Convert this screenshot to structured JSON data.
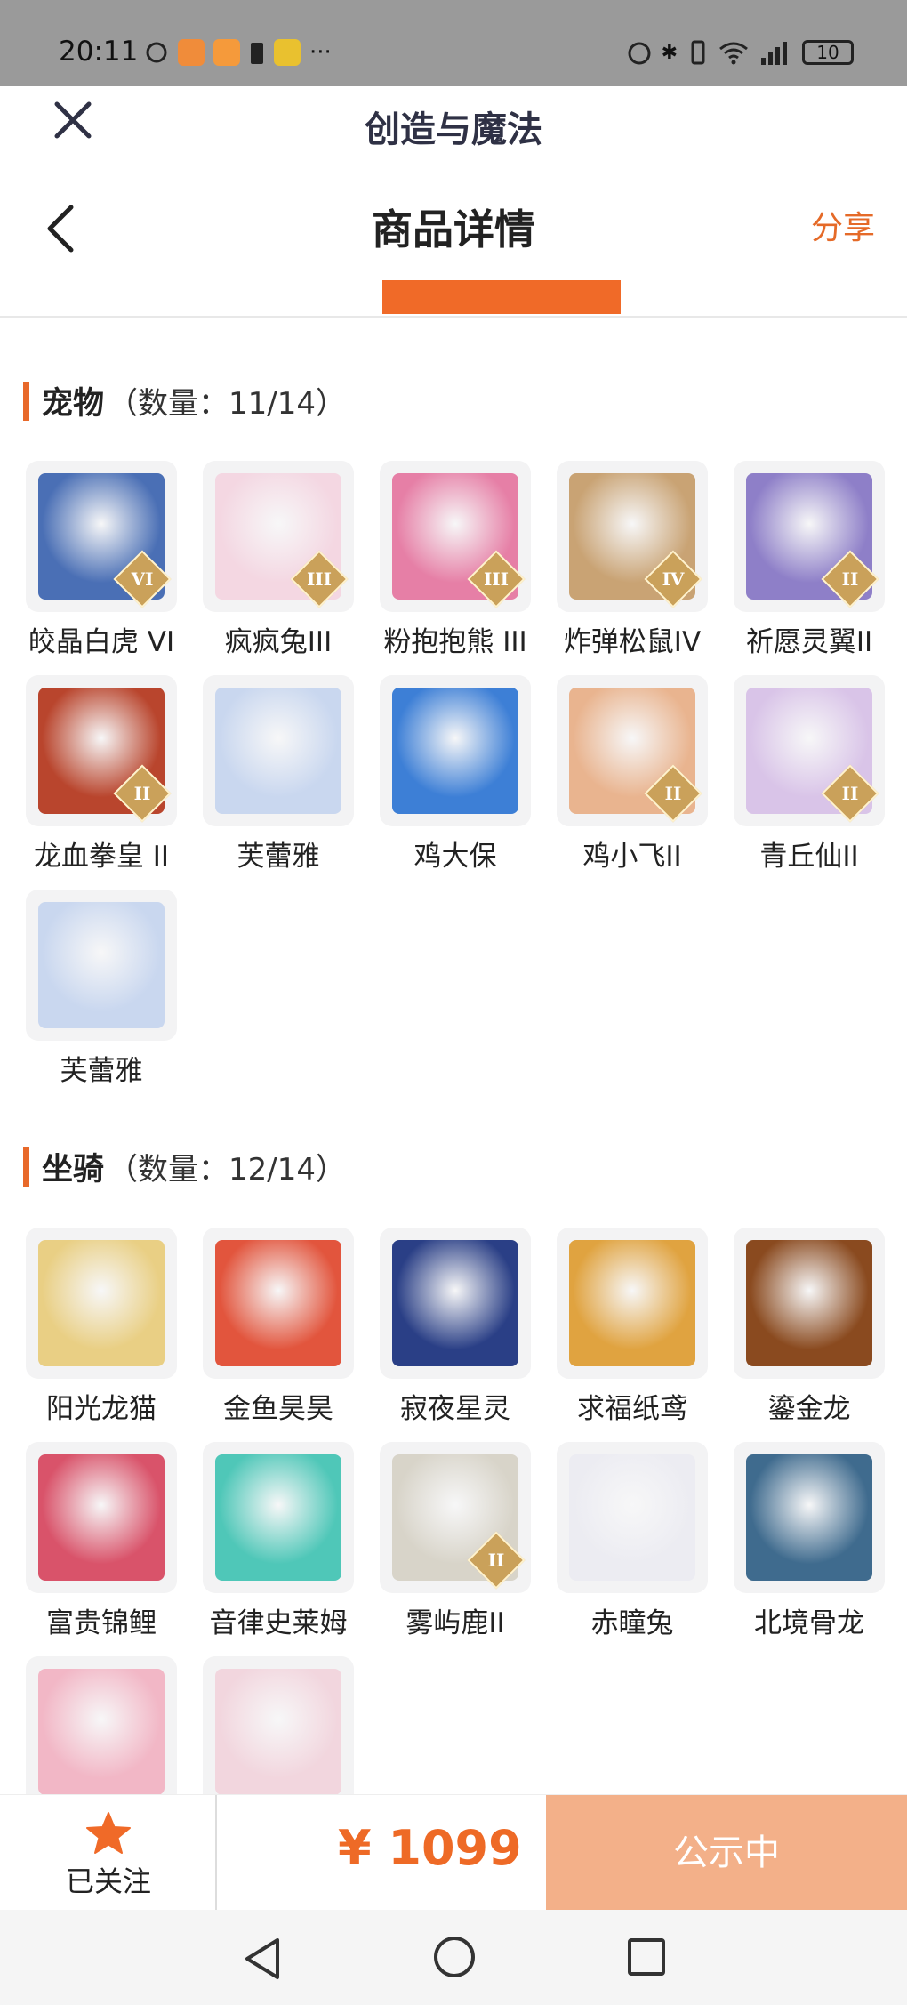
{
  "status_bar": {
    "time": "20:11",
    "battery": "10"
  },
  "app_bar": {
    "title": "创造与魔法"
  },
  "nav_bar": {
    "title": "商品详情",
    "share": "分享"
  },
  "sections": [
    {
      "name": "宠物",
      "count": "（数量：11/14）",
      "items": [
        {
          "name": "皎晶白虎 VI",
          "badge": "VI",
          "color": "#4a6fb5"
        },
        {
          "name": "疯疯兔III",
          "badge": "III",
          "color": "#f4d7e2"
        },
        {
          "name": "粉抱抱熊 III",
          "badge": "III",
          "color": "#e67fa6"
        },
        {
          "name": "炸弹松鼠IV",
          "badge": "IV",
          "color": "#c9a374"
        },
        {
          "name": "祈愿灵翼II",
          "badge": "II",
          "color": "#8e7fc8"
        },
        {
          "name": "龙血拳皇 II",
          "badge": "II",
          "color": "#b9452d"
        },
        {
          "name": "芙蕾雅",
          "badge": "",
          "color": "#c9d7ef"
        },
        {
          "name": "鸡大保",
          "badge": "",
          "color": "#3d7fd6"
        },
        {
          "name": "鸡小飞II",
          "badge": "II",
          "color": "#e9b48f"
        },
        {
          "name": "青丘仙II",
          "badge": "II",
          "color": "#d9c4e8"
        },
        {
          "name": "芙蕾雅",
          "badge": "",
          "color": "#c9d7ef"
        }
      ]
    },
    {
      "name": "坐骑",
      "count": "（数量：12/14）",
      "items": [
        {
          "name": "阳光龙猫",
          "badge": "",
          "color": "#e9cf84"
        },
        {
          "name": "金鱼昊昊",
          "badge": "",
          "color": "#e2553d"
        },
        {
          "name": "寂夜星灵",
          "badge": "",
          "color": "#2a3f86"
        },
        {
          "name": "求福纸鸢",
          "badge": "",
          "color": "#e0a340"
        },
        {
          "name": "鎏金龙",
          "badge": "",
          "color": "#8a4a1f"
        },
        {
          "name": "富贵锦鲤",
          "badge": "",
          "color": "#d9536a"
        },
        {
          "name": "音律史莱姆",
          "badge": "",
          "color": "#4fc7b8"
        },
        {
          "name": "雾屿鹿II",
          "badge": "II",
          "color": "#d8d4c9"
        },
        {
          "name": "赤瞳兔",
          "badge": "",
          "color": "#ececf2"
        },
        {
          "name": "北境骨龙",
          "badge": "",
          "color": "#3f6b8e"
        },
        {
          "name": "",
          "badge": "",
          "color": "#f2b7c6"
        },
        {
          "name": "",
          "badge": "",
          "color": "#f2d6de"
        }
      ]
    }
  ],
  "bottom_bar": {
    "follow_label": "已关注",
    "price": "¥ 1099",
    "action": "公示中"
  },
  "colors": {
    "accent": "#f06a28",
    "action_bg": "#f3b089",
    "thumb_bg": "#f3f3f4"
  }
}
